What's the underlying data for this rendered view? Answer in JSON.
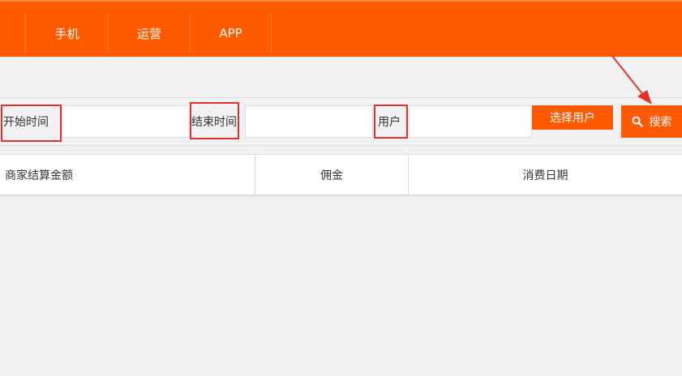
{
  "nav": {
    "items": [
      {
        "label": "手机"
      },
      {
        "label": "运营"
      },
      {
        "label": "APP"
      }
    ]
  },
  "filters": {
    "start_time_label": "开始时间",
    "end_time_label": "结束时间",
    "user_label": "用户",
    "start_time_value": "",
    "end_time_value": "",
    "user_value": "",
    "select_user_button": "选择用户",
    "search_button": "搜索"
  },
  "table": {
    "columns": [
      "商家结算金额",
      "佣金",
      "消费日期"
    ]
  },
  "colors": {
    "brand": "#ff5a00",
    "annotation": "#e83030"
  },
  "icons": {
    "search": "search-icon",
    "arrow": "annotation-arrow"
  }
}
